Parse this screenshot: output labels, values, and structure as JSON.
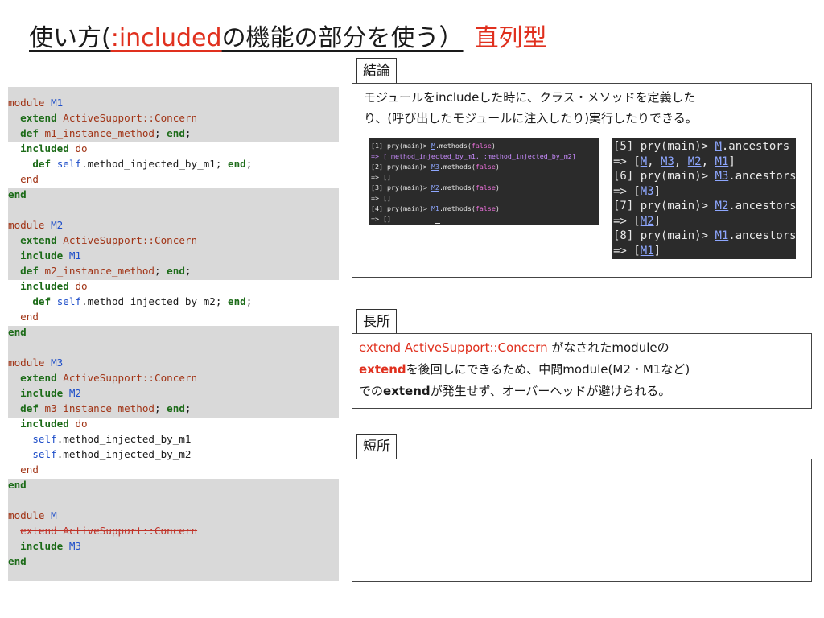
{
  "title": {
    "part1": "使い方",
    "part2": "(",
    "part3": ":included",
    "part4": "の機能の部分を使う）",
    "part5": "直列型"
  },
  "code": {
    "lines": [
      {
        "indent": "",
        "segments": [
          {
            "t": "module",
            "c": "tx"
          },
          {
            "t": " "
          },
          {
            "t": "M1",
            "c": "cn"
          }
        ]
      },
      {
        "indent": "  ",
        "segments": [
          {
            "t": "extend",
            "c": "kw"
          },
          {
            "t": " "
          },
          {
            "t": "ActiveSupport::Concern",
            "c": "tx"
          }
        ]
      },
      {
        "indent": "  ",
        "segments": [
          {
            "t": "def",
            "c": "kw"
          },
          {
            "t": " "
          },
          {
            "t": "m1_instance_method",
            "c": "tx"
          },
          {
            "t": "; "
          },
          {
            "t": "end",
            "c": "kw"
          },
          {
            "t": ";"
          }
        ]
      },
      {
        "indent": "  ",
        "segments": [
          {
            "t": "included",
            "c": "kw"
          },
          {
            "t": " "
          },
          {
            "t": "do",
            "c": "tx"
          }
        ]
      },
      {
        "indent": "    ",
        "segments": [
          {
            "t": "def",
            "c": "kw"
          },
          {
            "t": " "
          },
          {
            "t": "self",
            "c": "sf"
          },
          {
            "t": ".method_injected_by_m1; "
          },
          {
            "t": "end",
            "c": "kw"
          },
          {
            "t": ";"
          }
        ]
      },
      {
        "indent": "  ",
        "segments": [
          {
            "t": "end",
            "c": "tx"
          }
        ]
      },
      {
        "indent": "",
        "segments": [
          {
            "t": "end",
            "c": "kw"
          }
        ]
      },
      {
        "indent": "",
        "segments": []
      },
      {
        "indent": "",
        "segments": [
          {
            "t": "module",
            "c": "tx"
          },
          {
            "t": " "
          },
          {
            "t": "M2",
            "c": "cn"
          }
        ]
      },
      {
        "indent": "  ",
        "segments": [
          {
            "t": "extend",
            "c": "kw"
          },
          {
            "t": " "
          },
          {
            "t": "ActiveSupport::Concern",
            "c": "tx"
          }
        ]
      },
      {
        "indent": "  ",
        "segments": [
          {
            "t": "include",
            "c": "kw"
          },
          {
            "t": " "
          },
          {
            "t": "M1",
            "c": "cn"
          }
        ]
      },
      {
        "indent": "  ",
        "segments": [
          {
            "t": "def",
            "c": "kw"
          },
          {
            "t": " "
          },
          {
            "t": "m2_instance_method",
            "c": "tx"
          },
          {
            "t": "; "
          },
          {
            "t": "end",
            "c": "kw"
          },
          {
            "t": ";"
          }
        ]
      },
      {
        "indent": "  ",
        "segments": [
          {
            "t": "included",
            "c": "kw"
          },
          {
            "t": " "
          },
          {
            "t": "do",
            "c": "tx"
          }
        ]
      },
      {
        "indent": "    ",
        "segments": [
          {
            "t": "def",
            "c": "kw"
          },
          {
            "t": " "
          },
          {
            "t": "self",
            "c": "sf"
          },
          {
            "t": ".method_injected_by_m2; "
          },
          {
            "t": "end",
            "c": "kw"
          },
          {
            "t": ";"
          }
        ]
      },
      {
        "indent": "  ",
        "segments": [
          {
            "t": "end",
            "c": "tx"
          }
        ]
      },
      {
        "indent": "",
        "segments": [
          {
            "t": "end",
            "c": "kw"
          }
        ]
      },
      {
        "indent": "",
        "segments": []
      },
      {
        "indent": "",
        "segments": [
          {
            "t": "module",
            "c": "tx"
          },
          {
            "t": " "
          },
          {
            "t": "M3",
            "c": "cn"
          }
        ]
      },
      {
        "indent": "  ",
        "segments": [
          {
            "t": "extend",
            "c": "kw"
          },
          {
            "t": " "
          },
          {
            "t": "ActiveSupport::Concern",
            "c": "tx"
          }
        ]
      },
      {
        "indent": "  ",
        "segments": [
          {
            "t": "include",
            "c": "kw"
          },
          {
            "t": " "
          },
          {
            "t": "M2",
            "c": "cn"
          }
        ]
      },
      {
        "indent": "  ",
        "segments": [
          {
            "t": "def",
            "c": "kw"
          },
          {
            "t": " "
          },
          {
            "t": "m3_instance_method",
            "c": "tx"
          },
          {
            "t": "; "
          },
          {
            "t": "end",
            "c": "kw"
          },
          {
            "t": ";"
          }
        ]
      },
      {
        "indent": "  ",
        "segments": [
          {
            "t": "included",
            "c": "kw"
          },
          {
            "t": " "
          },
          {
            "t": "do",
            "c": "tx"
          }
        ]
      },
      {
        "indent": "    ",
        "segments": [
          {
            "t": "self",
            "c": "sf"
          },
          {
            "t": ".method_injected_by_m1"
          }
        ]
      },
      {
        "indent": "    ",
        "segments": [
          {
            "t": "self",
            "c": "sf"
          },
          {
            "t": ".method_injected_by_m2"
          }
        ]
      },
      {
        "indent": "  ",
        "segments": [
          {
            "t": "end",
            "c": "tx"
          }
        ]
      },
      {
        "indent": "",
        "segments": [
          {
            "t": "end",
            "c": "kw"
          }
        ]
      },
      {
        "indent": "",
        "segments": []
      },
      {
        "indent": "",
        "segments": [
          {
            "t": "module",
            "c": "tx"
          },
          {
            "t": " "
          },
          {
            "t": "M",
            "c": "cn"
          }
        ]
      },
      {
        "indent": "  ",
        "segments": [
          {
            "t": "extend ActiveSupport::Concern",
            "c": "strike"
          }
        ]
      },
      {
        "indent": "  ",
        "segments": [
          {
            "t": "include",
            "c": "kw"
          },
          {
            "t": " "
          },
          {
            "t": "M3",
            "c": "cn"
          }
        ]
      },
      {
        "indent": "",
        "segments": [
          {
            "t": "end",
            "c": "kw"
          }
        ]
      }
    ]
  },
  "conclusion": {
    "label": "結論",
    "line1": "モジュールをincludeした時に、クラス・メソッドを定義した",
    "line2": "り、(呼び出したモジュールに注入したり)実行したりできる。"
  },
  "terminal1": {
    "lines": [
      [
        {
          "t": "[1] pry(main)> "
        },
        {
          "t": "M",
          "c": "t-m"
        },
        {
          "t": ".methods("
        },
        {
          "t": "false",
          "c": "t-f"
        },
        {
          "t": ")"
        }
      ],
      [
        {
          "t": "=> [:method_injected_by_m1, :method_injected_by_m2]",
          "c": "t-s"
        }
      ],
      [
        {
          "t": "[2] pry(main)> "
        },
        {
          "t": "M3",
          "c": "t-m"
        },
        {
          "t": ".methods("
        },
        {
          "t": "false",
          "c": "t-f"
        },
        {
          "t": ")"
        }
      ],
      [
        {
          "t": "=> []"
        }
      ],
      [
        {
          "t": "[3] pry(main)> "
        },
        {
          "t": "M2",
          "c": "t-m"
        },
        {
          "t": ".methods("
        },
        {
          "t": "false",
          "c": "t-f"
        },
        {
          "t": ")"
        }
      ],
      [
        {
          "t": "=> []"
        }
      ],
      [
        {
          "t": "[4] pry(main)> "
        },
        {
          "t": "M1",
          "c": "t-m"
        },
        {
          "t": ".methods("
        },
        {
          "t": "false",
          "c": "t-f"
        },
        {
          "t": ")"
        }
      ],
      [
        {
          "t": "=> []"
        }
      ]
    ]
  },
  "terminal2": {
    "lines": [
      [
        {
          "t": "[5] pry(main)> "
        },
        {
          "t": "M",
          "c": "t-b"
        },
        {
          "t": ".ancestors"
        }
      ],
      [
        {
          "t": "=> ["
        },
        {
          "t": "M",
          "c": "t-b"
        },
        {
          "t": ", "
        },
        {
          "t": "M3",
          "c": "t-b"
        },
        {
          "t": ", "
        },
        {
          "t": "M2",
          "c": "t-b"
        },
        {
          "t": ", "
        },
        {
          "t": "M1",
          "c": "t-b"
        },
        {
          "t": "]"
        }
      ],
      [
        {
          "t": "[6] pry(main)> "
        },
        {
          "t": "M3",
          "c": "t-b"
        },
        {
          "t": ".ancestors"
        }
      ],
      [
        {
          "t": "=> ["
        },
        {
          "t": "M3",
          "c": "t-b"
        },
        {
          "t": "]"
        }
      ],
      [
        {
          "t": "[7] pry(main)> "
        },
        {
          "t": "M2",
          "c": "t-b"
        },
        {
          "t": ".ancestors"
        }
      ],
      [
        {
          "t": "=> ["
        },
        {
          "t": "M2",
          "c": "t-b"
        },
        {
          "t": "]"
        }
      ],
      [
        {
          "t": "[8] pry(main)> "
        },
        {
          "t": "M1",
          "c": "t-b"
        },
        {
          "t": ".ancestors"
        }
      ],
      [
        {
          "t": "=> ["
        },
        {
          "t": "M1",
          "c": "t-b"
        },
        {
          "t": "]"
        }
      ]
    ]
  },
  "advantage": {
    "label": "長所",
    "l1a": "extend ActiveSupport::Concern",
    "l1b": " がなされたmoduleの",
    "l2a": "extend",
    "l2b": "を後回しにできるため、中間module(M2・M1など)",
    "l3a": "での",
    "l3b": "extend",
    "l3c": "が発生せず、オーバーヘッドが避けられる。"
  },
  "disadvantage": {
    "label": "短所"
  }
}
